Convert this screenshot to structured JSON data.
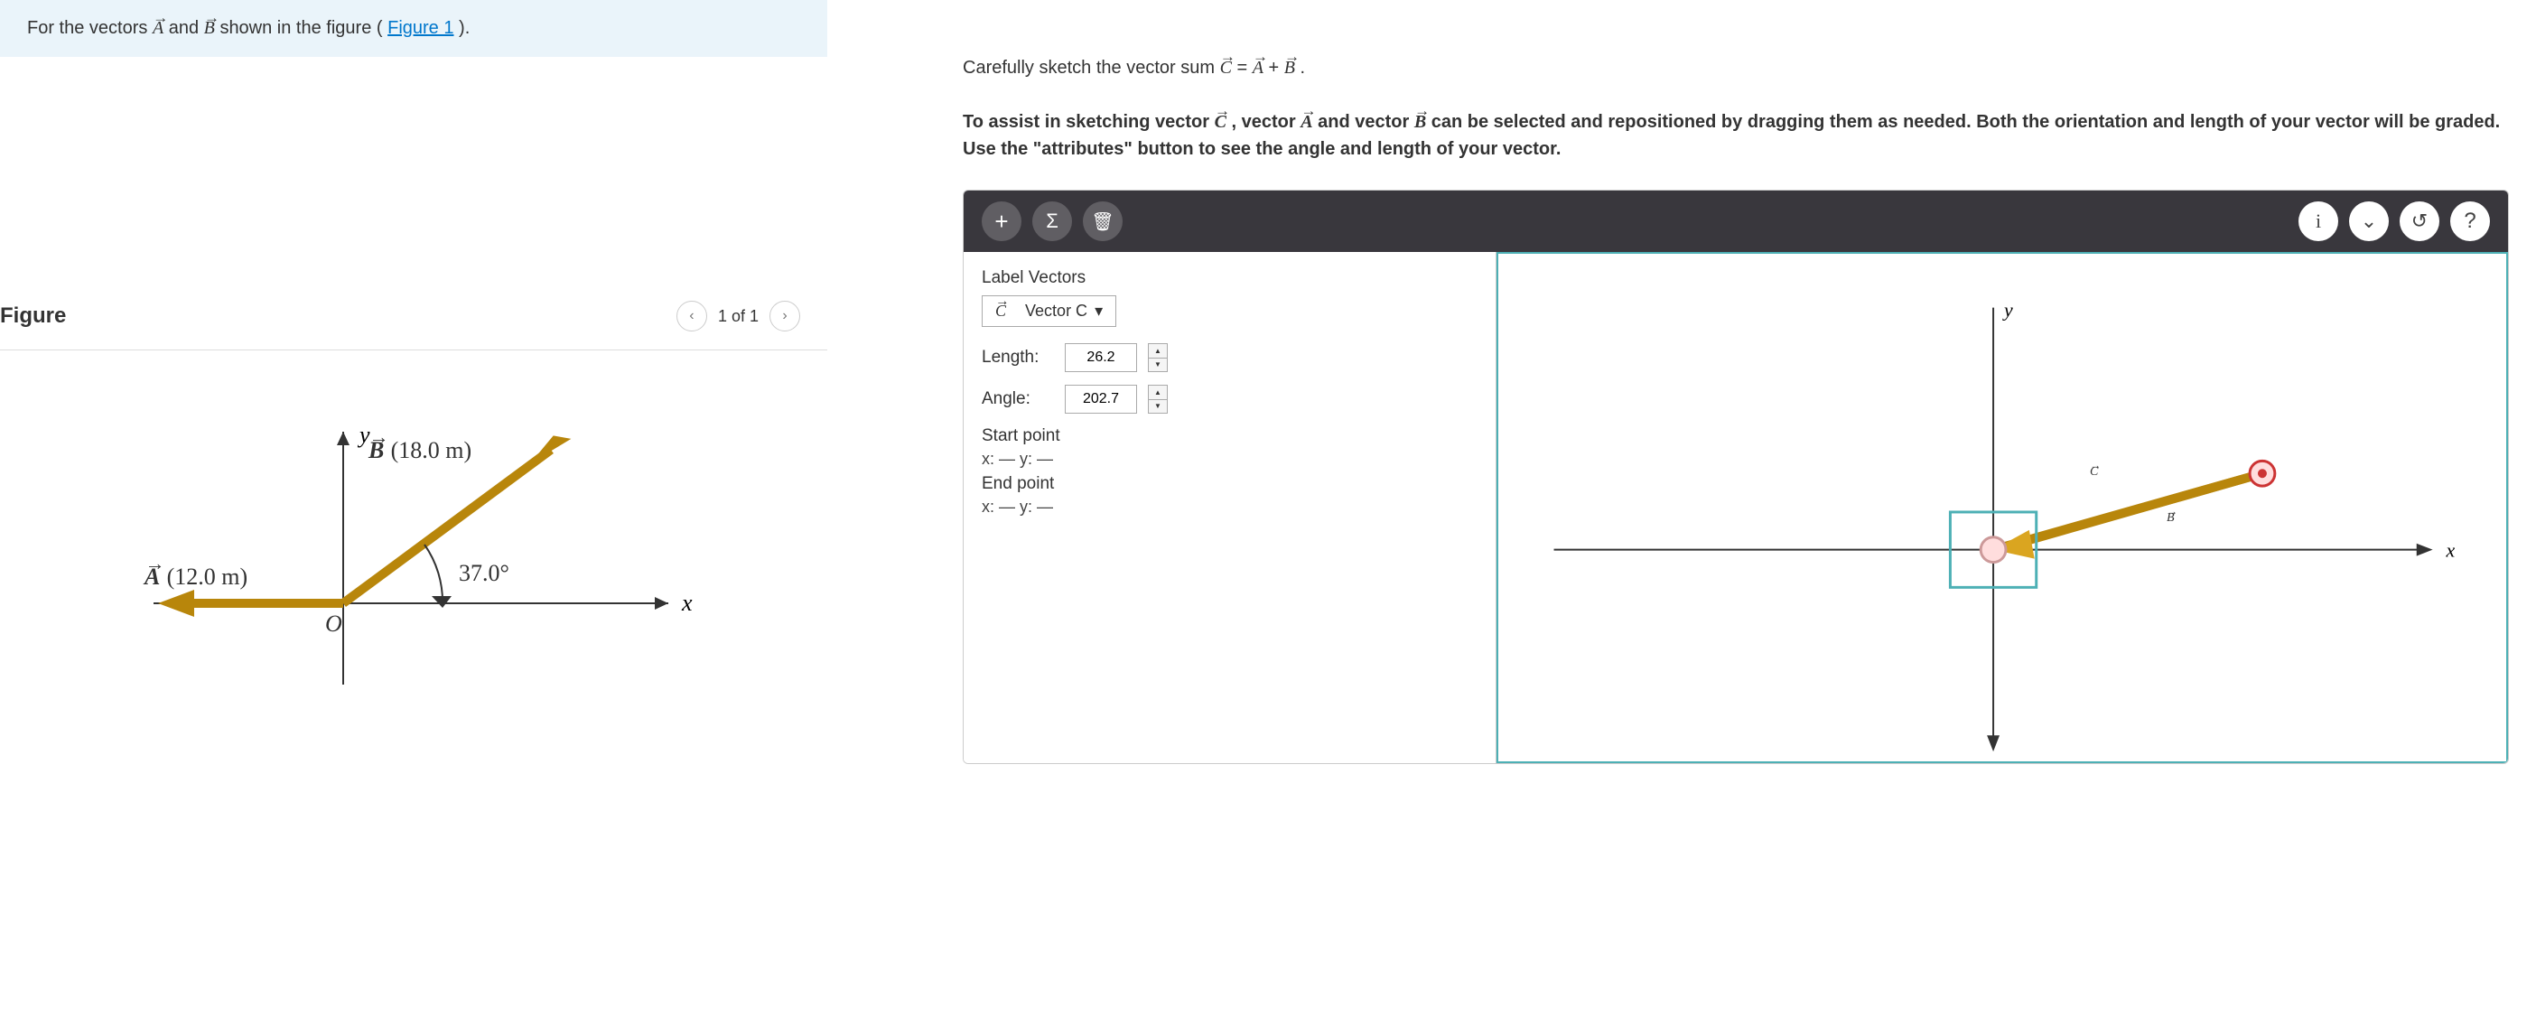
{
  "prompt": {
    "prefix": "For the vectors ",
    "A": "A",
    "and": " and ",
    "B": "B",
    "suffix": " shown in the figure (",
    "figLink": "Figure 1",
    "close": ")."
  },
  "instruction": {
    "line1_prefix": "Carefully sketch the vector sum ",
    "line1_C": "C",
    "line1_eq": " = ",
    "line1_A": "A",
    "line1_plus": " + ",
    "line1_B": "B",
    "line1_period": ".",
    "line2_a": "To assist in sketching vector ",
    "line2_C": "C",
    "line2_b": ", vector ",
    "line2_A": "A",
    "line2_c": " and vector ",
    "line2_B": "B",
    "line2_d": " can be selected and repositioned by dragging them as needed. Both the orientation and length of your vector will be graded. Use the \"attributes\" button to see the angle and length of your vector."
  },
  "figure": {
    "title": "Figure",
    "pager": "1 of 1",
    "A_label": "A",
    "A_mag": " (12.0 m)",
    "B_label": "B",
    "B_mag": " (18.0 m)",
    "angle": "37.0°",
    "origin": "O",
    "x": "x",
    "y": "y"
  },
  "panel": {
    "labelVectors": "Label Vectors",
    "vectorC": "Vector C",
    "vectorC_letter": "C",
    "lengthLabel": "Length:",
    "lengthValue": "26.2",
    "angleLabel": "Angle:",
    "angleValue": "202.7",
    "startPoint": "Start point",
    "startCoords": "x: — y: —",
    "endPoint": "End point",
    "endCoords": "x: — y: —"
  },
  "canvas": {
    "x": "x",
    "y": "y",
    "B": "B",
    "C": "C"
  },
  "icons": {
    "plus": "+",
    "sigma": "Σ",
    "trash": "🗑",
    "info": "i",
    "chevron": "⌄",
    "reset": "↺",
    "help": "?",
    "caret": "▾"
  }
}
